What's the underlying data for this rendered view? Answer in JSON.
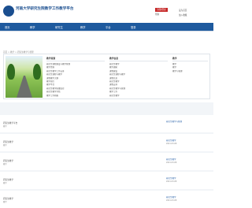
{
  "header": {
    "site_title": "河南大学研究生院教学工作教学平台",
    "register_button": "注册/登录",
    "help_link": "帮助",
    "right_link_1": "设为首页",
    "right_link_2": "加入收藏"
  },
  "nav": {
    "items": [
      "首页",
      "教学",
      "研究生",
      "教学",
      "平台",
      "登录"
    ]
  },
  "breadcrumb": "首页 > 教学 > 研究生教学与管理",
  "panel": {
    "col1": {
      "title": "教学资源",
      "items": [
        "研究生课程建设与教学管理",
        "教学资源",
        "研究生教学工作安排",
        "研究生课程与教学",
        "课程教学大纲",
        "教学日历",
        "教学平台",
        "研究生教学质量监控",
        "研究生教学评估",
        "教学工作简报"
      ]
    },
    "col2": {
      "title": "教学信息",
      "items": [
        "研究生教学",
        "教学通知",
        "课程建设",
        "研究生课程与教学",
        "课程信息",
        "研究生教学",
        "课程安排",
        "研究生教学与管理",
        "教学工作",
        "研究生教学"
      ]
    },
    "col3": {
      "title": "教学",
      "items": [
        "教学",
        "教学",
        "教学与管理"
      ]
    }
  },
  "cards": [
    {
      "title": "研究生教学平台",
      "sub": "教学",
      "right": "研究生教学与管理",
      "date": ""
    },
    {
      "title": "研究生教学",
      "sub": "教学",
      "right": "研究生教学",
      "date": "2021-03-08"
    },
    {
      "title": "研究生教学",
      "sub": "教学",
      "right": "研究生教学",
      "date": "2021-03-08"
    },
    {
      "title": "研究生教学",
      "sub": "教学",
      "right": "研究生教学",
      "date": "2021-03-08"
    },
    {
      "title": "研究生教学",
      "sub": "教学",
      "right": "研究生教学",
      "date": "2021-03-08"
    }
  ]
}
